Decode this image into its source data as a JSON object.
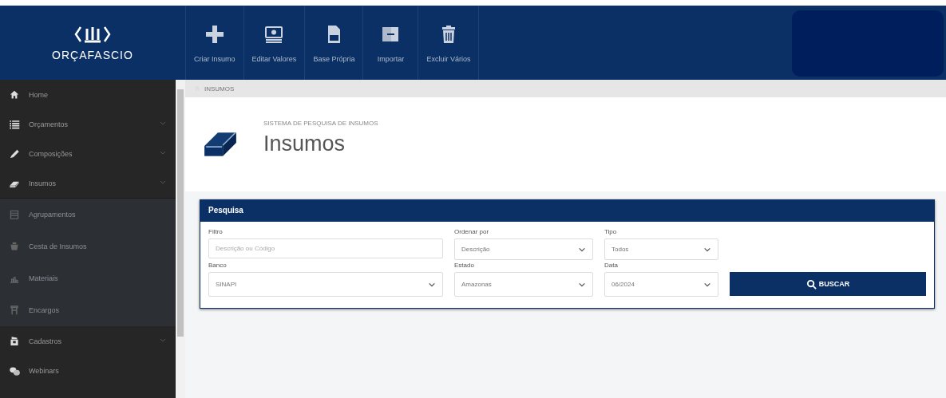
{
  "header": {
    "logo_text": "ORÇAFASCIO",
    "toolbar": [
      {
        "label": "Criar Insumo"
      },
      {
        "label": "Editar Valores"
      },
      {
        "label": "Base Própria"
      },
      {
        "label": "Importar"
      },
      {
        "label": "Excluir Vários"
      }
    ]
  },
  "sidebar": {
    "items": [
      {
        "label": "Home",
        "expanded": false
      },
      {
        "label": "Orçamentos",
        "expanded": false
      },
      {
        "label": "Composições",
        "expanded": false
      },
      {
        "label": "Insumos",
        "expanded": true,
        "children": [
          {
            "label": "Agrupamentos"
          },
          {
            "label": "Cesta de Insumos"
          },
          {
            "label": "Materiais"
          },
          {
            "label": "Encargos"
          }
        ]
      },
      {
        "label": "Cadastros",
        "expanded": false
      },
      {
        "label": "Webinars",
        "expanded": false
      }
    ]
  },
  "breadcrumb": "INSUMOS",
  "page": {
    "subtitle": "SISTEMA DE PESQUISA DE INSUMOS",
    "title": "Insumos"
  },
  "search_panel": {
    "title": "Pesquisa",
    "fields": [
      {
        "kind": "text",
        "label": "Filtro",
        "placeholder": "Descrição ou Código"
      },
      {
        "kind": "select",
        "label": "Ordenar por",
        "value": "Descrição"
      },
      {
        "kind": "select",
        "label": "Tipo",
        "value": "Todos"
      },
      {
        "kind": "select",
        "label": "Banco",
        "value": "SINAPI"
      },
      {
        "kind": "select",
        "label": "Estado",
        "value": "Amazonas"
      },
      {
        "kind": "select",
        "label": "Data",
        "value": "06/2024"
      }
    ],
    "button": "BUSCAR"
  }
}
